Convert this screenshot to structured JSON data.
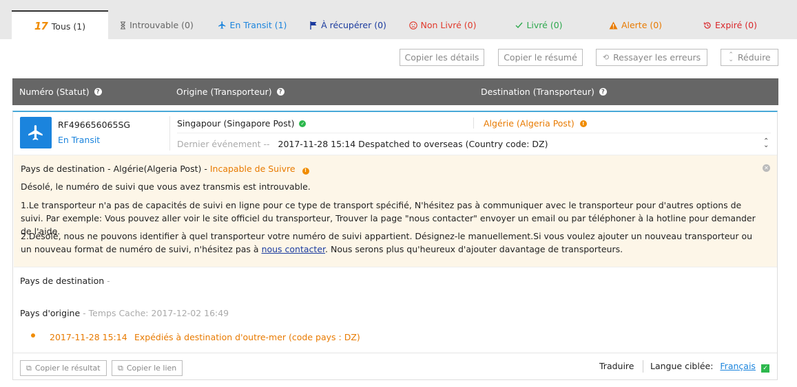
{
  "tabs": [
    {
      "label": "Tous (1)",
      "color": "#333333",
      "icon": "17track-logo",
      "logo_text": "17"
    },
    {
      "label": "Introuvable (0)",
      "color": "#666666",
      "icon": "hourglass-icon"
    },
    {
      "label": "En Transit (1)",
      "color": "#1b84dd",
      "icon": "plane-icon"
    },
    {
      "label": "À récupérer (0)",
      "color": "#1a3a9e",
      "icon": "flag-icon"
    },
    {
      "label": "Non Livré (0)",
      "color": "#e0392b",
      "icon": "sad-face-icon"
    },
    {
      "label": "Livré (0)",
      "color": "#2da84d",
      "icon": "check-icon"
    },
    {
      "label": "Alerte (0)",
      "color": "#e87a00",
      "icon": "warning-icon"
    },
    {
      "label": "Expiré (0)",
      "color": "#d9262a",
      "icon": "history-icon"
    }
  ],
  "toolbar": {
    "copy_details": "Copier les détails",
    "copy_summary": "Copier le résumé",
    "retry_errors": "Ressayer les erreurs",
    "collapse": "Réduire"
  },
  "table_header": {
    "number": "Numéro (Statut)",
    "origin": "Origine (Transporteur)",
    "destination": "Destination (Transporteur)"
  },
  "shipment": {
    "tracking_number": "RF496656065SG",
    "status": "En Transit",
    "origin": "Singapour (Singapore Post)",
    "destination": "Algérie (Algeria Post)",
    "last_event_label": "Dernier événement --",
    "last_event": "2017-11-28 15:14 Despatched to overseas (Country code: DZ)"
  },
  "alert": {
    "title_prefix": "Pays de destination - Algérie(Algeria Post) -",
    "title_status": "Incapable de Suivre",
    "line1": "Désolé, le numéro de suivi que vous avez transmis est introuvable.",
    "para1": "1.Le transporteur n'a pas de capacités de suivi en ligne pour ce type de transport spécifié, N'hésitez pas à communiquer avec le transporteur pour d'autres options de suivi. Par exemple: Vous pouvez aller voir le site officiel du transporteur, Trouver la page \"nous contacter\" envoyer un email ou par téléphoner à la hotline pour demander de l'aide.",
    "para2_before": "2.Désolé, nous ne pouvons identifier à quel transporteur votre numéro de suivi appartient. Désignez-le manuellement.Si vous voulez ajouter un nouveau transporteur ou un nouveau format de numéro de suivi, n'hésitez pas à ",
    "para2_link": "nous contacter",
    "para2_after": ". Nous serons plus qu'heureux d'ajouter davantage de transporteurs."
  },
  "destination_section": {
    "label": "Pays de destination",
    "value": "-"
  },
  "origin_section": {
    "label": "Pays d'origine",
    "cache": "- Temps Cache: 2017-12-02 16:49"
  },
  "events": [
    {
      "time": "2017-11-28 15:14",
      "text": "Expédiés à destination d'outre-mer (code pays : DZ)"
    }
  ],
  "footer": {
    "copy_result": "Copier le résultat",
    "copy_link": "Copier le lien",
    "translate": "Traduire",
    "target_lang_label": "Langue ciblée:",
    "target_lang": "Français"
  }
}
